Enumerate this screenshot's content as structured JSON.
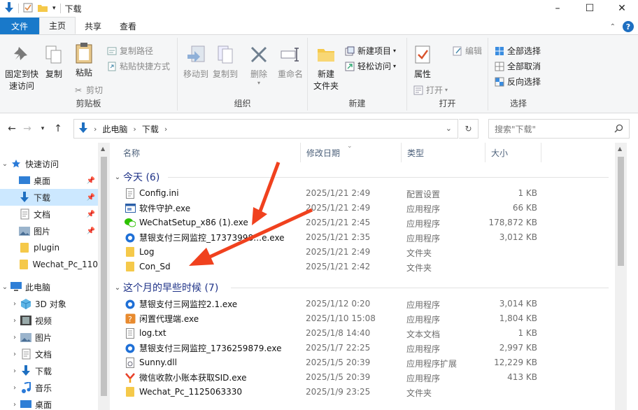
{
  "window": {
    "title": "下载",
    "controls": {
      "minimize": "–",
      "maximize": "☐",
      "close": "✕"
    }
  },
  "tabs": [
    "文件",
    "主页",
    "共享",
    "查看"
  ],
  "ribbon": {
    "clipboard": {
      "label": "剪贴板",
      "pin_quick": "固定到快\n速访问",
      "copy": "复制",
      "paste": "粘贴",
      "copy_path": "复制路径",
      "paste_shortcut": "粘贴快捷方式",
      "cut": "剪切"
    },
    "organize": {
      "label": "组织",
      "move_to": "移动到",
      "copy_to": "复制到",
      "delete": "删除",
      "rename": "重命名"
    },
    "new": {
      "label": "新建",
      "new_folder": "新建\n文件夹",
      "new_item": "新建项目",
      "easy_access": "轻松访问"
    },
    "open": {
      "label": "打开",
      "properties": "属性",
      "open": "打开",
      "edit": "编辑"
    },
    "select": {
      "label": "选择",
      "select_all": "全部选择",
      "select_none": "全部取消",
      "invert": "反向选择"
    }
  },
  "address": {
    "crumbs": [
      "此电脑",
      "下载"
    ],
    "search_placeholder": "搜索\"下载\""
  },
  "navpane": {
    "quick_access": "快速访问",
    "items": [
      {
        "label": "桌面",
        "icon": "desktop-icon",
        "pinned": true
      },
      {
        "label": "下载",
        "icon": "download-icon",
        "pinned": true,
        "selected": true
      },
      {
        "label": "文档",
        "icon": "document-icon",
        "pinned": true
      },
      {
        "label": "图片",
        "icon": "picture-icon",
        "pinned": true
      },
      {
        "label": "plugin",
        "icon": "folder-icon"
      },
      {
        "label": "Wechat_Pc_110",
        "icon": "folder-icon"
      }
    ],
    "this_pc": "此电脑",
    "pc_items": [
      {
        "label": "3D 对象",
        "icon": "3d-objects-icon"
      },
      {
        "label": "视频",
        "icon": "video-icon"
      },
      {
        "label": "图片",
        "icon": "picture-icon"
      },
      {
        "label": "文档",
        "icon": "document-icon"
      },
      {
        "label": "下载",
        "icon": "download-icon"
      },
      {
        "label": "音乐",
        "icon": "music-icon"
      },
      {
        "label": "桌面",
        "icon": "desktop-icon"
      }
    ]
  },
  "columns": [
    "名称",
    "修改日期",
    "类型",
    "大小"
  ],
  "groups": [
    {
      "label": "今天 (6)",
      "files": [
        {
          "name": "Config.ini",
          "date": "2025/1/21 2:49",
          "type": "配置设置",
          "size": "1 KB",
          "icon": "ini-file-icon"
        },
        {
          "name": "软件守护.exe",
          "date": "2025/1/21 2:49",
          "type": "应用程序",
          "size": "66 KB",
          "icon": "exe-window-icon"
        },
        {
          "name": "WeChatSetup_x86 (1).exe",
          "date": "2025/1/21 2:45",
          "type": "应用程序",
          "size": "178,872 KB",
          "icon": "wechat-icon"
        },
        {
          "name": "慧银支付三网监控_17373998…e.exe",
          "date": "2025/1/21 2:35",
          "type": "应用程序",
          "size": "3,012 KB",
          "icon": "blue-circle-app-icon"
        },
        {
          "name": "Log",
          "date": "2025/1/21 2:49",
          "type": "文件夹",
          "size": "",
          "icon": "folder-icon"
        },
        {
          "name": "Con_Sd",
          "date": "2025/1/21 2:42",
          "type": "文件夹",
          "size": "",
          "icon": "folder-icon"
        }
      ]
    },
    {
      "label": "这个月的早些时候 (7)",
      "files": [
        {
          "name": "慧银支付三网监控2.1.exe",
          "date": "2025/1/12 0:20",
          "type": "应用程序",
          "size": "3,014 KB",
          "icon": "blue-circle-app-icon"
        },
        {
          "name": "闲置代理端.exe",
          "date": "2025/1/10 15:08",
          "type": "应用程序",
          "size": "1,804 KB",
          "icon": "question-app-icon"
        },
        {
          "name": "log.txt",
          "date": "2025/1/8 14:40",
          "type": "文本文档",
          "size": "1 KB",
          "icon": "text-file-icon"
        },
        {
          "name": "慧银支付三网监控_1736259879.exe",
          "date": "2025/1/7 22:25",
          "type": "应用程序",
          "size": "2,997 KB",
          "icon": "blue-circle-app-icon"
        },
        {
          "name": "Sunny.dll",
          "date": "2025/1/5 20:39",
          "type": "应用程序扩展",
          "size": "12,229 KB",
          "icon": "dll-file-icon"
        },
        {
          "name": "微信收款小账本获取SID.exe",
          "date": "2025/1/5 20:39",
          "type": "应用程序",
          "size": "413 KB",
          "icon": "y-app-icon"
        },
        {
          "name": "Wechat_Pc_1125063330",
          "date": "2025/1/9 23:25",
          "type": "文件夹",
          "size": "",
          "icon": "folder-icon"
        }
      ]
    }
  ],
  "colors": {
    "accent": "#1979ca",
    "group_header": "#1e3287",
    "selected": "#cce8ff",
    "annotation_arrow": "#f0411e"
  }
}
